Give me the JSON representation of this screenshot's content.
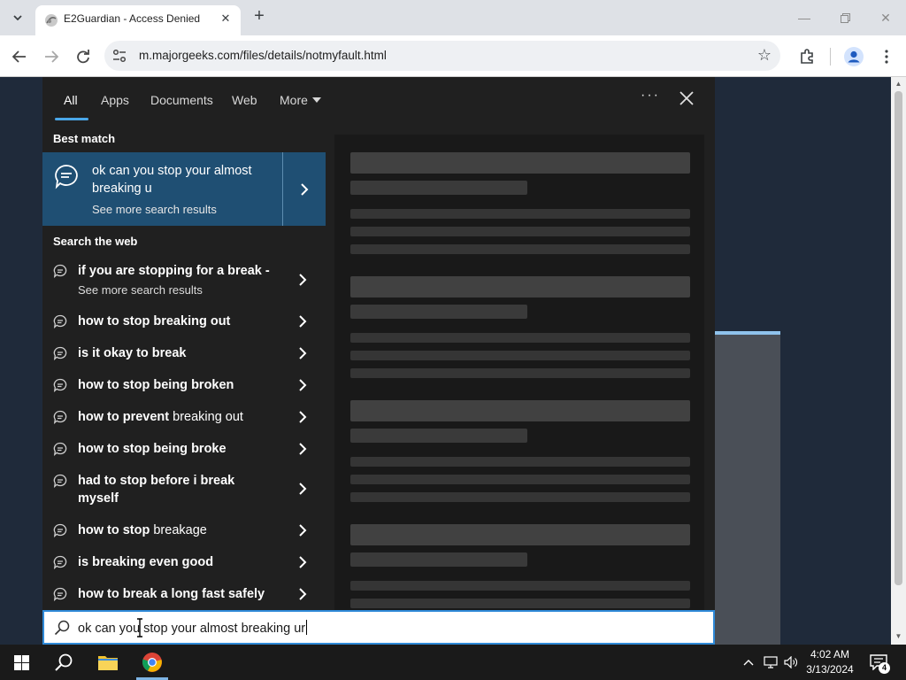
{
  "browser": {
    "tab_title": "E2Guardian - Access Denied",
    "url": "m.majorgeeks.com/files/details/notmyfault.html"
  },
  "search": {
    "tabs": [
      "All",
      "Apps",
      "Documents",
      "Web",
      "More"
    ],
    "active_tab": "All",
    "best_match_label": "Best match",
    "best_match_title": "ok can you stop your almost breaking u",
    "best_match_sub": "See more search results",
    "web_label": "Search the web",
    "web_items": [
      {
        "pre": "",
        "bold": "if you are stopping for a break -",
        "post": "",
        "sub": "See more search results"
      },
      {
        "pre": "",
        "bold": "how to stop breaking out",
        "post": "",
        "sub": ""
      },
      {
        "pre": "is it ",
        "bold": "okay to break",
        "post": "",
        "sub": ""
      },
      {
        "pre": "",
        "bold": "how to stop being broken",
        "post": "",
        "sub": ""
      },
      {
        "pre": "",
        "bold": "how to prevent",
        "post": " breaking out",
        "sub": ""
      },
      {
        "pre": "",
        "bold": "how to stop being broke",
        "post": "",
        "sub": ""
      },
      {
        "pre": "",
        "bold": "had to stop before i break myself",
        "post": "",
        "sub": ""
      },
      {
        "pre": "",
        "bold": "how to stop",
        "post": " breakage",
        "sub": ""
      },
      {
        "pre": "is ",
        "bold": "breaking even good",
        "post": "",
        "sub": ""
      },
      {
        "pre": "",
        "bold": "how to break a long fast safely",
        "post": "",
        "sub": ""
      }
    ],
    "query": "ok can you stop your almost breaking ur"
  },
  "taskbar": {
    "time": "4:02 AM",
    "date": "3/13/2024",
    "notification_count": "4"
  },
  "colors": {
    "accent": "#4aa7e8",
    "best_match_bg": "#1f4f73",
    "panel_bg": "#202020"
  }
}
